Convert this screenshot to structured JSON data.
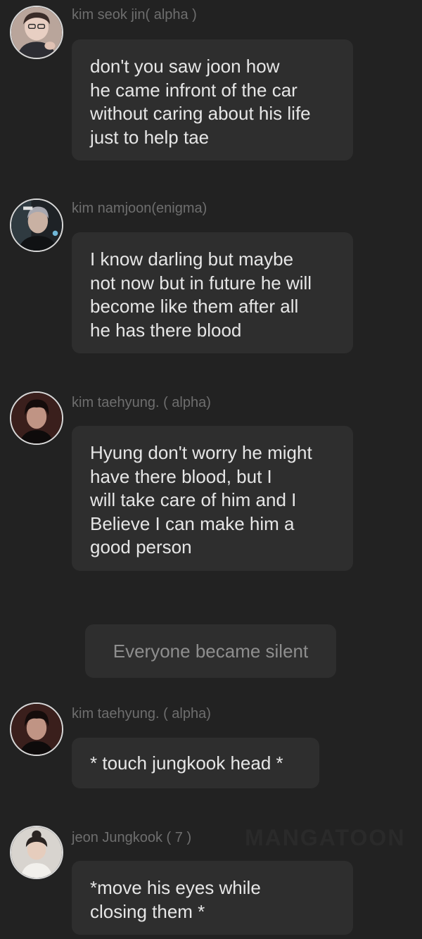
{
  "messages": [
    {
      "name": "kim seok jin( alpha )",
      "lines": [
        "don't you saw joon how",
        "he came infront of the car",
        "without caring about his life",
        "just to help tae"
      ]
    },
    {
      "name": "kim namjoon(enigma)",
      "lines": [
        "I know darling but maybe",
        "not now but in future he will",
        "become like them after all",
        "he has there blood"
      ]
    },
    {
      "name": "kim taehyung. ( alpha)",
      "lines": [
        "Hyung don't worry he might",
        "have there blood, but I",
        "will take care of him and I",
        "Believe I can make him a",
        "good person"
      ]
    },
    {
      "name": "kim taehyung. ( alpha)",
      "lines": [
        "* touch jungkook head *"
      ]
    },
    {
      "name": "jeon Jungkook ( 7 )",
      "lines": [
        "*move his eyes while",
        "closing them *"
      ]
    }
  ],
  "narration": "Everyone became silent",
  "watermark": "MANGATOON",
  "colors": {
    "background": "#222222",
    "bubble": "#2e2e2e",
    "name": "#6e6e6e",
    "text": "#e6e6e6",
    "narration_text": "#8e8e8e"
  }
}
